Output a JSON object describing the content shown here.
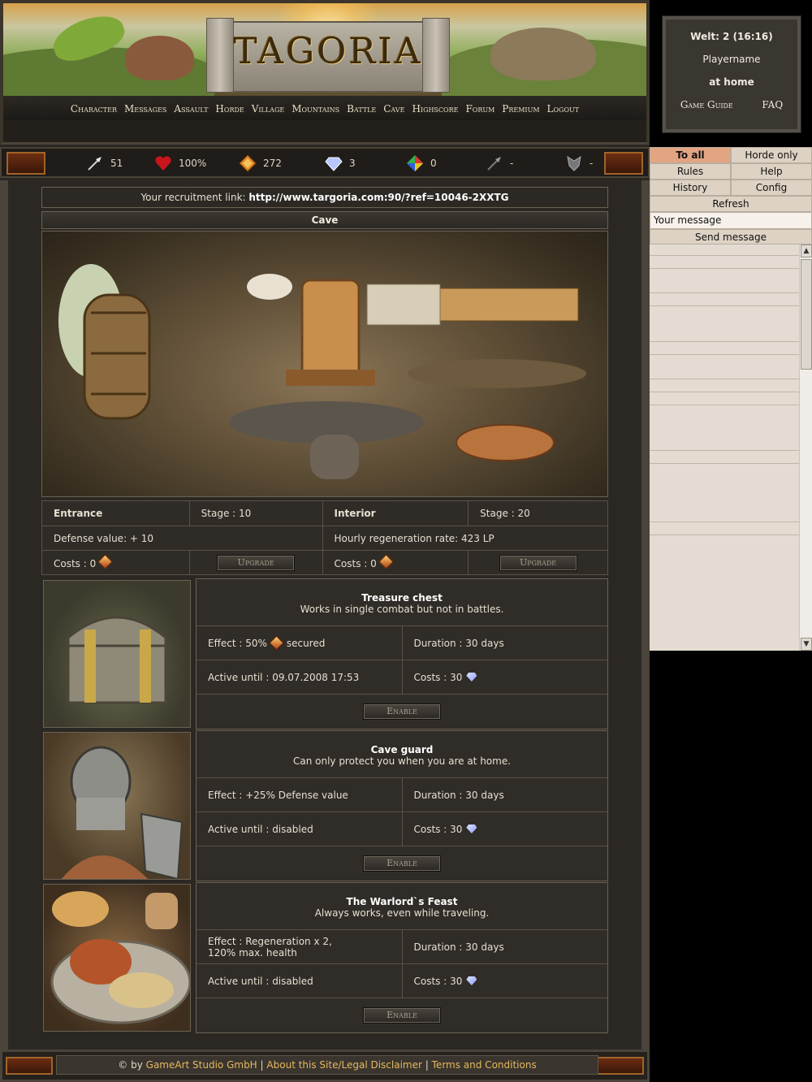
{
  "brand": {
    "logo": "TAGORIA"
  },
  "nav": [
    "Character",
    "Messages",
    "Assault",
    "Horde",
    "Village",
    "Mountains",
    "Battle",
    "Cave",
    "Highscore",
    "Forum",
    "Premium",
    "Logout"
  ],
  "stats": [
    {
      "icon": "arrow-icon",
      "value": "51"
    },
    {
      "icon": "heart-icon",
      "value": "100%"
    },
    {
      "icon": "gold-gem-icon",
      "value": "272"
    },
    {
      "icon": "diamond-icon",
      "value": "3"
    },
    {
      "icon": "rainbow-gem-icon",
      "value": "0"
    },
    {
      "icon": "dark-arrow-icon",
      "value": "-"
    },
    {
      "icon": "shield-icon",
      "value": "-"
    }
  ],
  "recruit": {
    "label": "Your recruitment link:",
    "link": "http://www.targoria.com:90/?ref=10046-2XXTG"
  },
  "cave": {
    "title": "Cave",
    "entrance": {
      "label": "Entrance",
      "stage": "Stage : 10",
      "defense": "Defense value: + 10",
      "costs": "Costs : 0",
      "button": "Upgrade"
    },
    "interior": {
      "label": "Interior",
      "stage": "Stage : 20",
      "regen": "Hourly regeneration rate: 423 LP",
      "costs": "Costs : 0",
      "button": "Upgrade"
    }
  },
  "items": [
    {
      "title": "Treasure chest",
      "desc": "Works in single combat but not in battles.",
      "effect_prefix": "Effect : 50%",
      "effect_suffix": "secured",
      "duration": "Duration : 30 days",
      "active": "Active until : 09.07.2008 17:53",
      "costs": "Costs : 30",
      "button": "Enable"
    },
    {
      "title": "Cave guard",
      "desc": "Can only protect you when you are at home.",
      "effect": "Effect : +25% Defense value",
      "duration": "Duration : 30 days",
      "active": "Active until : disabled",
      "costs": "Costs : 30",
      "button": "Enable"
    },
    {
      "title": "The Warlord`s Feast",
      "desc": "Always works, even while traveling.",
      "effect_line1": "Effect : Regeneration x 2,",
      "effect_line2": "120% max. health",
      "duration": "Duration : 30 days",
      "active": "Active until : disabled",
      "costs": "Costs : 30",
      "button": "Enable"
    }
  ],
  "footer": {
    "prefix": "© by",
    "studio": "GameArt Studio GmbH",
    "about": "About this Site/Legal Disclaimer",
    "terms": "Terms and Conditions",
    "sep": "|"
  },
  "world": {
    "title": "Welt: 2 (16:16)",
    "player": "Playername",
    "location": "at home",
    "guide": "Game Guide",
    "faq": "FAQ"
  },
  "chat": {
    "tabs": [
      {
        "label": "To all",
        "active": true
      },
      {
        "label": "Horde only",
        "active": false
      }
    ],
    "row2": [
      "Rules",
      "Help"
    ],
    "row3": [
      "History",
      "Config"
    ],
    "refresh": "Refresh",
    "message_placeholder": "Your message",
    "send": "Send message"
  },
  "colors": {
    "accent": "#e3a482",
    "link": "#e6b860",
    "panel": "#302c27"
  }
}
